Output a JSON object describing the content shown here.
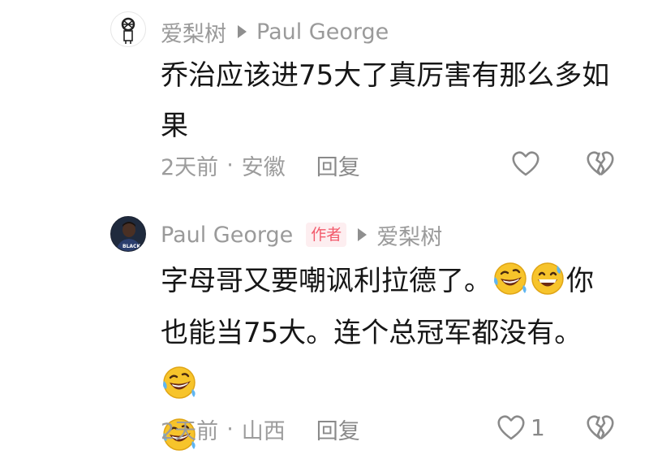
{
  "comments": [
    {
      "username": "爱梨树",
      "reply_to": "Paul George",
      "text": "乔治应该进75大了真厉害有那么多如果",
      "time": "2天前",
      "separator": "·",
      "location": "安徽",
      "reply_label": "回复"
    },
    {
      "username": "Paul George",
      "badge": "作者",
      "reply_to": "爱梨树",
      "text_1": "字母哥又要嘲讽利拉德了。",
      "text_2": "你",
      "text_3": "也能当75大。连个总冠军都没有。",
      "time": "2天前",
      "separator": "·",
      "location": "山西",
      "reply_label": "回复",
      "like_count": "1"
    }
  ],
  "colors": {
    "username": "#9a9a9a",
    "text": "#161616",
    "badge": "#f25a6b",
    "icon": "#888888"
  },
  "emoji_names": [
    "rolling-on-floor-laughing",
    "grinning-sweat",
    "rolling-on-floor-laughing",
    "rolling-on-floor-laughing"
  ]
}
